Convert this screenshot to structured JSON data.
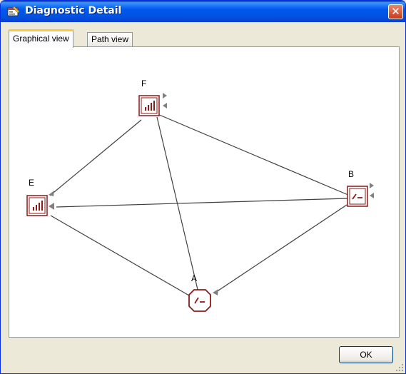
{
  "window": {
    "title": "Diagnostic Detail",
    "title_icon": "properties-icon",
    "close_icon": "close-icon",
    "close_glyph": "✕"
  },
  "tabs": [
    {
      "label": "Graphical view",
      "selected": true
    },
    {
      "label": "Path view",
      "selected": false
    }
  ],
  "graph": {
    "nodes": [
      {
        "id": "F",
        "label": "F",
        "icon": "bar-chart-icon"
      },
      {
        "id": "E",
        "label": "E",
        "icon": "bar-chart-icon"
      },
      {
        "id": "B",
        "label": "B",
        "icon": "switch-icon"
      },
      {
        "id": "A",
        "label": "A",
        "icon": "switch-icon"
      }
    ],
    "edges": [
      [
        "F",
        "E"
      ],
      [
        "F",
        "B"
      ],
      [
        "F",
        "A"
      ],
      [
        "E",
        "B"
      ],
      [
        "E",
        "A"
      ],
      [
        "B",
        "A"
      ]
    ],
    "colors": {
      "node_border": "#8b1a1a",
      "edge": "#404040",
      "arrow": "#808080"
    }
  },
  "buttons": {
    "ok_label": "OK"
  }
}
